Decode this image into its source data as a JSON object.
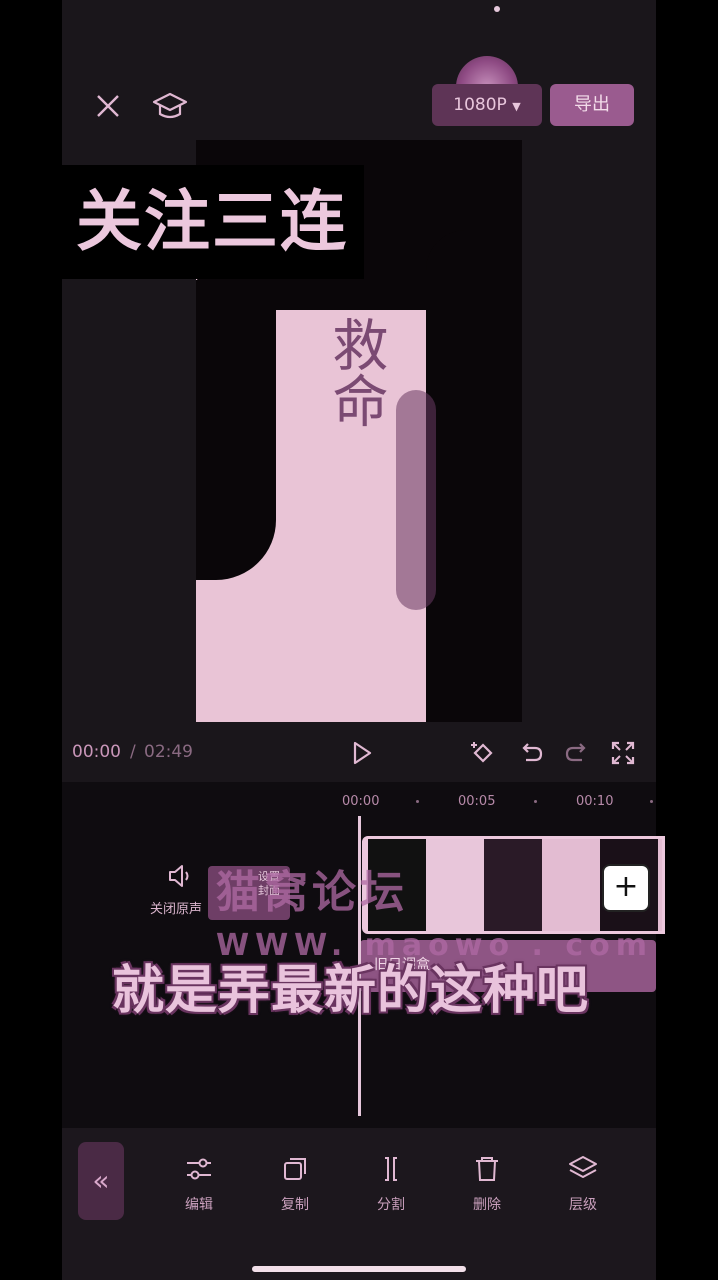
{
  "header": {
    "resolution": "1080P",
    "export_label": "导出"
  },
  "preview": {
    "overlay_title": "关注三连",
    "tattoo_text": "救命"
  },
  "playback": {
    "current_time": "00:00",
    "separator": "/",
    "total_time": "02:49"
  },
  "timeline": {
    "ruler": [
      "00:00",
      "00:05",
      "00:10"
    ],
    "audio_label": "关闭原声",
    "cover_label": "设置封面",
    "text_track_label": "旧日调盒",
    "add_clip": "+"
  },
  "overlays": {
    "watermark": "猫窝论坛",
    "watermark_url": "WWW. maowo . com",
    "subtitle": "就是弄最新的这种吧"
  },
  "toolbar": {
    "collapse": "«",
    "items": [
      {
        "label": "编辑",
        "icon": "sliders-icon"
      },
      {
        "label": "复制",
        "icon": "copy-icon"
      },
      {
        "label": "分割",
        "icon": "split-icon"
      },
      {
        "label": "删除",
        "icon": "trash-icon"
      },
      {
        "label": "层级",
        "icon": "layers-icon"
      }
    ]
  },
  "colors": {
    "accent": "#9a5b8f",
    "text": "#e8c6dc",
    "background": "#1a161b"
  }
}
